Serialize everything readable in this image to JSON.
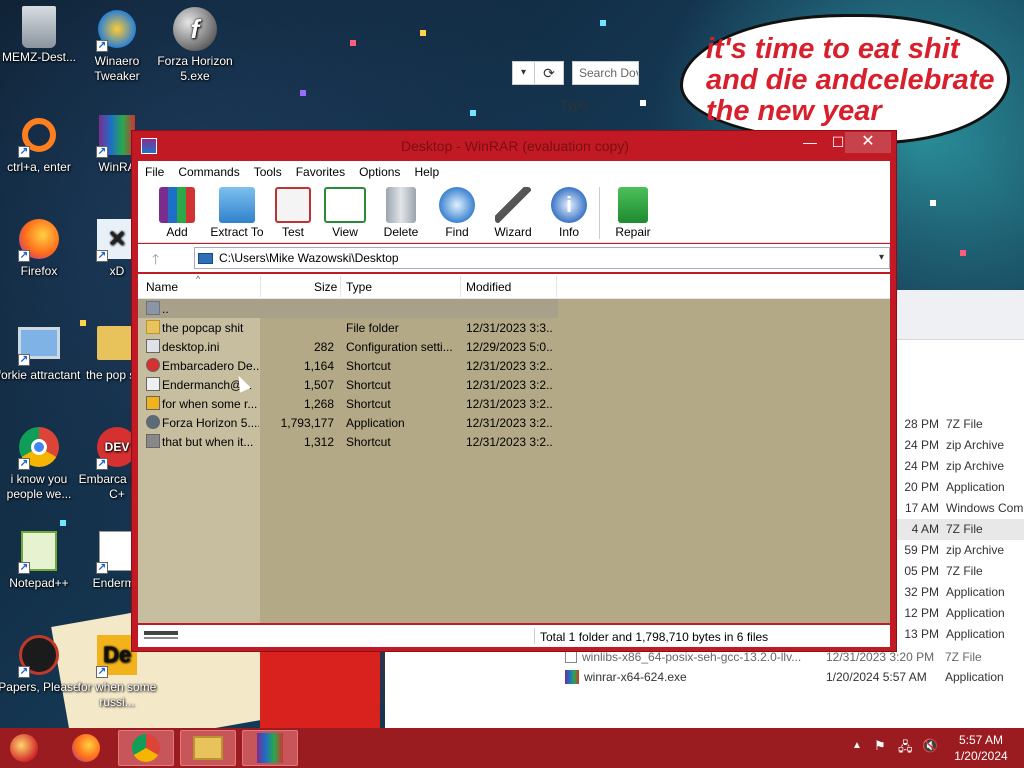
{
  "desktop": {
    "bubble_text": [
      "it's time to eat shit",
      "and die andcelebrate",
      "the new year"
    ],
    "icons": [
      {
        "label": "MEMZ-Dest...",
        "icon": "recycle-bin-icon"
      },
      {
        "label": "Winaero Tweaker",
        "icon": "winaero-icon"
      },
      {
        "label": "Forza Horizon 5.exe",
        "icon": "flash-icon"
      },
      {
        "label": "ctrl+a, enter",
        "icon": "ring-icon"
      },
      {
        "label": "WinRA",
        "icon": "winrar-icon"
      },
      {
        "label": "Firefox",
        "icon": "firefox-icon"
      },
      {
        "label": "xD",
        "icon": "xd-icon"
      },
      {
        "label": "forkie attractant",
        "icon": "monitor-icon"
      },
      {
        "label": "the pop shit",
        "icon": "folder-icon"
      },
      {
        "label": "i know you people we...",
        "icon": "chrome-icon"
      },
      {
        "label": "Embarca Dev-C+",
        "icon": "devcpp-icon"
      },
      {
        "label": "Notepad++",
        "icon": "notepadpp-icon"
      },
      {
        "label": "Enderma",
        "icon": "app-icon"
      },
      {
        "label": "Papers, Please",
        "icon": "papers-please-icon"
      },
      {
        "label": "for when some russi...",
        "icon": "de-icon"
      }
    ]
  },
  "explorer": {
    "search_placeholder": "Search Dov",
    "type_header": "Type",
    "rows": [
      {
        "time": "28 PM",
        "type": "7Z File"
      },
      {
        "time": "24 PM",
        "type": "zip Archive"
      },
      {
        "time": "24 PM",
        "type": "zip Archive"
      },
      {
        "time": "20 PM",
        "type": "Application"
      },
      {
        "time": "17 AM",
        "type": "Windows Com"
      },
      {
        "time": "4 AM",
        "type": "7Z File"
      },
      {
        "time": "59 PM",
        "type": "zip Archive"
      },
      {
        "time": "05 PM",
        "type": "7Z File"
      },
      {
        "time": "32 PM",
        "type": "Application"
      },
      {
        "time": "12 PM",
        "type": "Application"
      },
      {
        "time": "13 PM",
        "type": "Application"
      }
    ],
    "file1": {
      "name": "winlibs-x86_64-posix-seh-gcc-13.2.0-llv...",
      "date": "12/31/2023 3:20 PM",
      "type": "7Z File"
    },
    "file2": {
      "name": "winrar-x64-624.exe",
      "date": "1/20/2024 5:57 AM",
      "type": "Application"
    }
  },
  "winrar": {
    "title": "Desktop - WinRAR (evaluation copy)",
    "menu": [
      "File",
      "Commands",
      "Tools",
      "Favorites",
      "Options",
      "Help"
    ],
    "toolbar": [
      {
        "label": "Add",
        "icon": "add-archive-icon"
      },
      {
        "label": "Extract To",
        "icon": "extract-folder-icon"
      },
      {
        "label": "Test",
        "icon": "test-clipboard-icon"
      },
      {
        "label": "View",
        "icon": "view-book-icon"
      },
      {
        "label": "Delete",
        "icon": "trash-can-icon"
      },
      {
        "label": "Find",
        "icon": "magnifier-icon"
      },
      {
        "label": "Wizard",
        "icon": "magic-wand-icon"
      },
      {
        "label": "Info",
        "icon": "info-icon"
      },
      {
        "label": "Repair",
        "icon": "repair-icon"
      }
    ],
    "path": "C:\\Users\\Mike Wazowski\\Desktop",
    "columns": {
      "name": "Name",
      "size": "Size",
      "type": "Type",
      "modified": "Modified"
    },
    "up_row": "..",
    "files": [
      {
        "name": "the popcap shit",
        "size": "",
        "type": "File folder",
        "modified": "12/31/2023 3:3...",
        "icon": "folder-icon",
        "color": "#e8c25a"
      },
      {
        "name": "desktop.ini",
        "size": "282",
        "type": "Configuration setti...",
        "modified": "12/29/2023 5:0...",
        "icon": "settings-file-icon",
        "color": "#dfe3e8"
      },
      {
        "name": "Embarcadero De...",
        "size": "1,164",
        "type": "Shortcut",
        "modified": "12/31/2023 3:2...",
        "icon": "devcpp-icon",
        "color": "#d63031"
      },
      {
        "name": "Endermanch@...",
        "size": "1,507",
        "type": "Shortcut",
        "modified": "12/31/2023 3:2...",
        "icon": "app-icon",
        "color": "#f0f0f0"
      },
      {
        "name": "for when some r...",
        "size": "1,268",
        "type": "Shortcut",
        "modified": "12/31/2023 3:2...",
        "icon": "de-icon",
        "color": "#f2b21b"
      },
      {
        "name": "Forza Horizon 5....",
        "size": "1,793,177",
        "type": "Application",
        "modified": "12/31/2023 3:2...",
        "icon": "flash-icon",
        "color": "#5b6b7a"
      },
      {
        "name": "that but when it...",
        "size": "1,312",
        "type": "Shortcut",
        "modified": "12/31/2023 3:2...",
        "icon": "file-icon",
        "color": "#888888"
      }
    ],
    "status": "Total 1 folder and 1,798,710 bytes in 6 files"
  },
  "taskbar": {
    "apps": [
      "start-orb",
      "firefox-icon",
      "chrome-icon",
      "file-explorer-icon",
      "winrar-icon"
    ],
    "time": "5:57 AM",
    "date": "1/20/2024"
  },
  "colors": {
    "winrar_frame": "#c21a24",
    "taskbar": "#9b1c20",
    "list_bg": "#b4a986"
  }
}
